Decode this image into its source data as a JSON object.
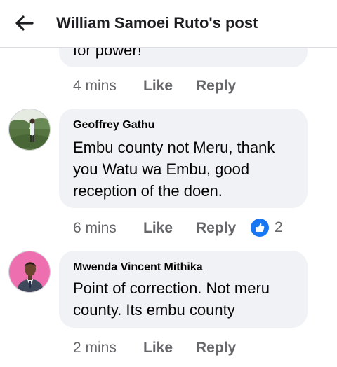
{
  "header": {
    "title": "William Samoei Ruto's post",
    "back_icon": "arrow-left-icon"
  },
  "comments": [
    {
      "text_partial": "for power!",
      "time": "4 mins",
      "like_label": "Like",
      "reply_label": "Reply"
    },
    {
      "author": "Geoffrey Gathu",
      "text_lines": [
        "Embu county not Meru, thank",
        "you Watu wa Embu, good",
        "reception of the doen."
      ],
      "time": "6 mins",
      "like_label": "Like",
      "reply_label": "Reply",
      "reaction_icon": "thumbs-up-icon",
      "reaction_count": "2"
    },
    {
      "author": "Mwenda Vincent Mithika",
      "text_lines": [
        "Point of correction. Not meru",
        "county. Its embu county"
      ],
      "time": "2 mins",
      "like_label": "Like",
      "reply_label": "Reply"
    }
  ],
  "colors": {
    "bubble_bg": "#f0f2f5",
    "meta_text": "#65676b",
    "like_blue": "#1877f2"
  }
}
